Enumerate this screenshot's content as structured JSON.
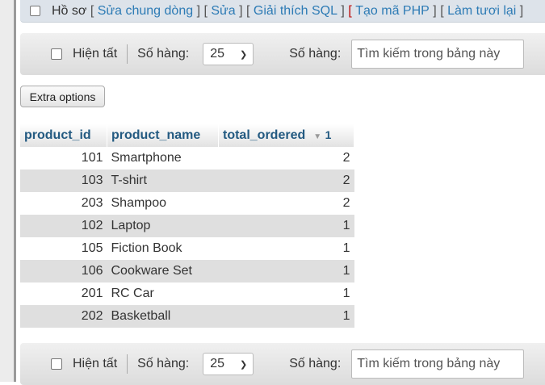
{
  "topbar": {
    "profile": "Hồ sơ",
    "links": [
      "Sửa chung dòng",
      "Sửa",
      "Giải thích SQL",
      "Tạo mã PHP",
      "Làm tươi lại"
    ]
  },
  "toolbar": {
    "show_all": "Hiện tất",
    "rows_label": "Số hàng:",
    "rows_value": "25",
    "filter_label": "Số hàng:",
    "search_placeholder": "Tìm kiếm trong bảng này"
  },
  "extra_options": "Extra options",
  "table": {
    "columns": [
      "product_id",
      "product_name",
      "total_ordered"
    ],
    "sort_index": "1",
    "rows": [
      [
        "101",
        "Smartphone",
        "2"
      ],
      [
        "103",
        "T-shirt",
        "2"
      ],
      [
        "203",
        "Shampoo",
        "2"
      ],
      [
        "102",
        "Laptop",
        "1"
      ],
      [
        "105",
        "Fiction Book",
        "1"
      ],
      [
        "106",
        "Cookware Set",
        "1"
      ],
      [
        "201",
        "RC Car",
        "1"
      ],
      [
        "202",
        "Basketball",
        "1"
      ]
    ]
  }
}
